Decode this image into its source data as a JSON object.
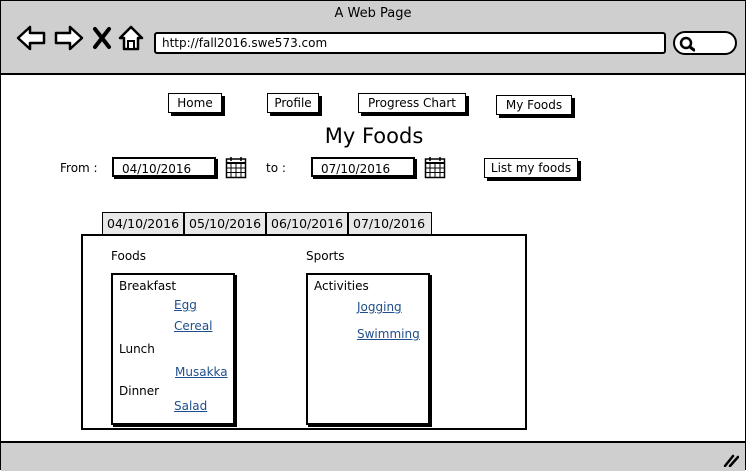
{
  "window": {
    "title": "A Web Page",
    "url": "http://fall2016.swe573.com"
  },
  "nav": {
    "home": "Home",
    "profile": "Profile",
    "progress_chart": "Progress Chart",
    "my_foods": "My Foods"
  },
  "page": {
    "title": "My Foods"
  },
  "filter": {
    "from_label": "From :",
    "from_date": "04/10/2016",
    "to_label": "to :",
    "to_date": "07/10/2016",
    "list_button": "List my foods"
  },
  "tabs": [
    "04/10/2016",
    "05/10/2016",
    "06/10/2016",
    "07/10/2016"
  ],
  "foods": {
    "label": "Foods",
    "breakfast": "Breakfast",
    "breakfast_items": [
      "Egg",
      "Cereal"
    ],
    "lunch": "Lunch",
    "lunch_items": [
      "Musakka"
    ],
    "dinner": "Dinner",
    "dinner_items": [
      "Salad"
    ]
  },
  "sports": {
    "label": "Sports",
    "activities": "Activities",
    "items": [
      "Jogging",
      "Swimming"
    ]
  },
  "icons": [
    "back-arrow-icon",
    "forward-arrow-icon",
    "close-icon",
    "home-icon",
    "search-icon",
    "calendar-icon",
    "resize-icon"
  ]
}
